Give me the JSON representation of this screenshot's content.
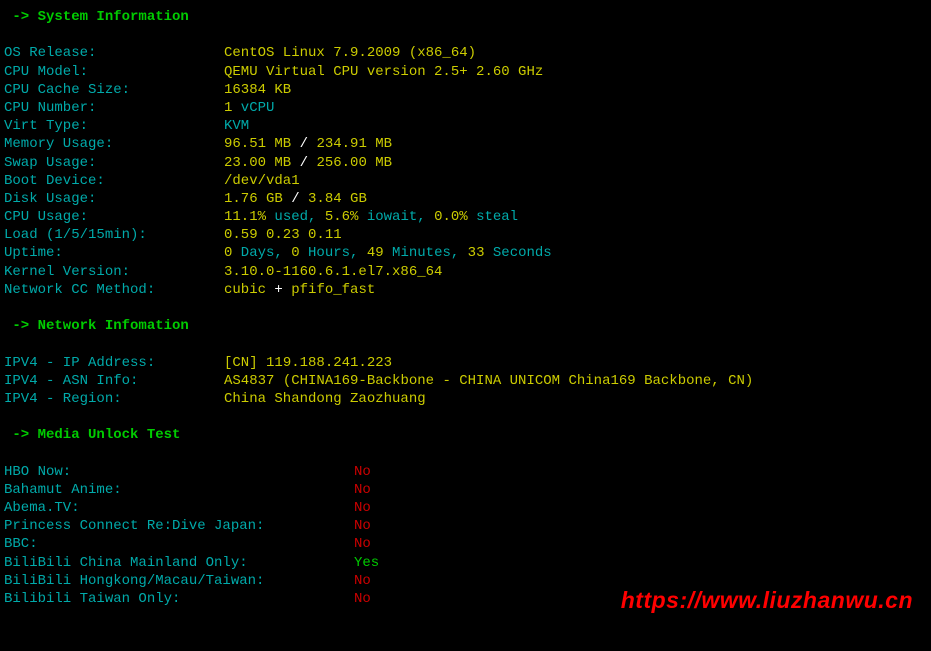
{
  "headers": {
    "sysinfo": " -> System Information",
    "netinfo": " -> Network Infomation",
    "mediaunlock": " -> Media Unlock Test"
  },
  "sysinfo": {
    "os_release_label": " OS Release:",
    "os_release_value": "CentOS Linux 7.9.2009 (x86_64)",
    "cpu_model_label": " CPU Model:",
    "cpu_model_value": "QEMU Virtual CPU version 2.5+  2.60 GHz",
    "cpu_cache_label": " CPU Cache Size:",
    "cpu_cache_value": "16384 KB",
    "cpu_number_label": " CPU Number:",
    "cpu_number_count": "1",
    "cpu_number_suffix": " vCPU",
    "virt_type_label": " Virt Type:",
    "virt_type_value": "KVM",
    "memory_label": " Memory Usage:",
    "memory_used": "96.51 MB",
    "memory_sep": " / ",
    "memory_total": "234.91 MB",
    "swap_label": " Swap Usage:",
    "swap_used": "23.00 MB",
    "swap_sep": " / ",
    "swap_total": "256.00 MB",
    "boot_label": " Boot Device:",
    "boot_value": "/dev/vda1",
    "disk_label": " Disk Usage:",
    "disk_used": "1.76 GB",
    "disk_sep": " / ",
    "disk_total": "3.84 GB",
    "cpu_usage_label": " CPU Usage:",
    "cpu_usage_used": "11.1%",
    "cpu_usage_used_suffix": " used, ",
    "cpu_usage_iowait": "5.6%",
    "cpu_usage_iowait_suffix": " iowait, ",
    "cpu_usage_steal": "0.0%",
    "cpu_usage_steal_suffix": " steal",
    "load_label": " Load (1/5/15min):",
    "load_value": "0.59 0.23 0.11",
    "uptime_label": " Uptime:",
    "uptime_days": "0",
    "uptime_days_suffix": " Days, ",
    "uptime_hours": "0",
    "uptime_hours_suffix": " Hours, ",
    "uptime_minutes": "49",
    "uptime_minutes_suffix": " Minutes, ",
    "uptime_seconds": "33",
    "uptime_seconds_suffix": " Seconds",
    "kernel_label": " Kernel Version:",
    "kernel_value": "3.10.0-1160.6.1.el7.x86_64",
    "netcc_label": " Network CC Method:",
    "netcc_main": "cubic",
    "netcc_sep": " + ",
    "netcc_qdisc": "pfifo_fast"
  },
  "netinfo": {
    "ipv4_addr_label": " IPV4 - IP Address:",
    "ipv4_addr_cc": "[CN] ",
    "ipv4_addr_value": "119.188.241.223",
    "ipv4_asn_label": " IPV4 - ASN Info:",
    "ipv4_asn_num": "AS4837",
    "ipv4_asn_value": " (CHINA169-Backbone - CHINA UNICOM China169 Backbone, CN)",
    "ipv4_region_label": " IPV4 - Region:",
    "ipv4_region_value": "China Shandong Zaozhuang"
  },
  "media": {
    "hbo_label": " HBO Now:",
    "hbo_value": "No",
    "bahamut_label": " Bahamut Anime:",
    "bahamut_value": "No",
    "abema_label": " Abema.TV:",
    "abema_value": "No",
    "princess_label": " Princess Connect Re:Dive Japan:",
    "princess_value": "No",
    "bbc_label": " BBC:",
    "bbc_value": "No",
    "bilibili_cn_label": " BiliBili China Mainland Only:",
    "bilibili_cn_value": "Yes",
    "bilibili_hk_label": " BiliBili Hongkong/Macau/Taiwan:",
    "bilibili_hk_value": "No",
    "bilibili_tw_label": " Bilibili Taiwan Only:",
    "bilibili_tw_value": "No"
  },
  "watermark": "https://www.liuzhanwu.cn"
}
